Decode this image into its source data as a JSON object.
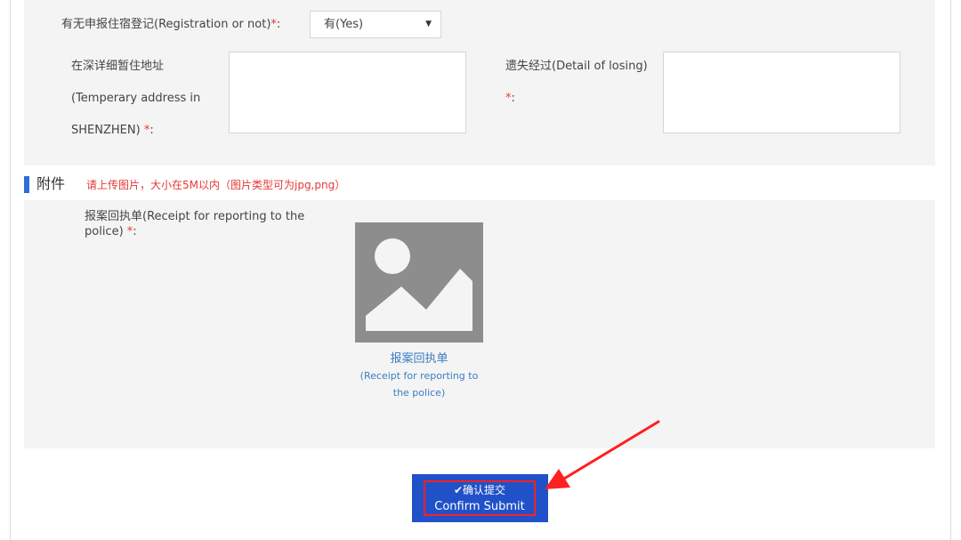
{
  "form": {
    "registration": {
      "label": "有无申报住宿登记(Registration or not)",
      "required": "*",
      "colon": ":",
      "selected": "有(Yes)"
    },
    "address": {
      "line1": "在深详细暂住地址",
      "line2": "(Temperary address in",
      "line3": "SHENZHEN)",
      "required": "*",
      "colon": ":"
    },
    "detail": {
      "label": "遗失经过(Detail of losing)",
      "required": "*",
      "colon": ":"
    }
  },
  "attachment": {
    "title": "附件",
    "note": "请上传图片，大小在5M以内（图片类型可为jpg,png）",
    "receipt_label_line1": "报案回执单(Receipt for reporting to the",
    "receipt_label_line2": "police)",
    "required": "*",
    "colon": ":",
    "caption_cn": "报案回执单",
    "caption_en_line1": "(Receipt for reporting to",
    "caption_en_line2": "the police)",
    "placeholder_icon": "image-placeholder-icon"
  },
  "submit": {
    "icon": "checkmark-icon",
    "label_cn": "确认提交",
    "label_en": "Confirm Submit"
  },
  "colors": {
    "accent_blue": "#2151c8",
    "section_bar": "#2f6cd8",
    "required_red": "#e53935",
    "highlight_red": "#ff2020",
    "panel_bg": "#f4f4f4",
    "link_blue": "#3a7dc2"
  }
}
